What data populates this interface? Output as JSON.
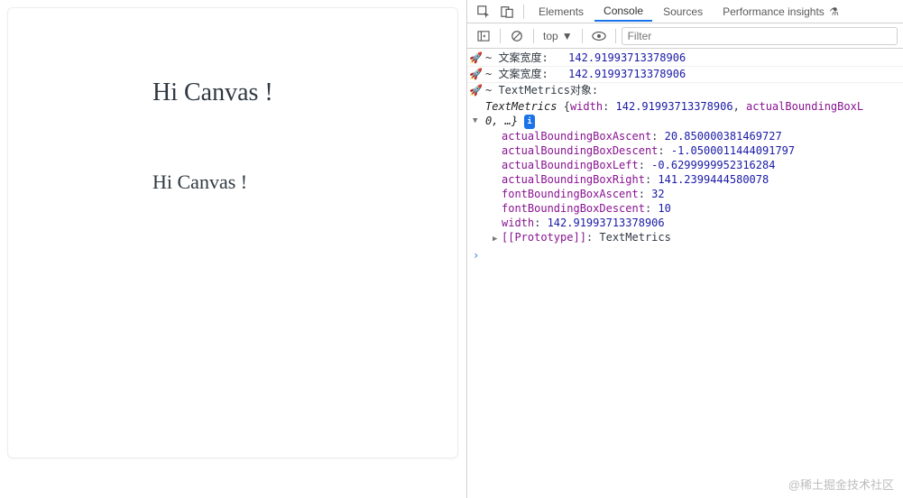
{
  "canvas": {
    "text1": "Hi Canvas !",
    "text2": "Hi Canvas !"
  },
  "devtools": {
    "tabs": {
      "elements": "Elements",
      "console": "Console",
      "sources": "Sources",
      "perf": "Performance insights"
    },
    "filterbar": {
      "context": "top",
      "filter_placeholder": "Filter"
    },
    "console": {
      "rocket": "🚀",
      "log1_label": "~ 文案宽度:",
      "log1_value": "142.91993713378906",
      "log2_label": "~ 文案宽度:",
      "log2_value": "142.91993713378906",
      "log3_label": "~ TextMetrics对象:",
      "summary_pre": "TextMetrics ",
      "summary_open": "{",
      "summary_prop1": "width",
      "summary_sep": ": ",
      "summary_val1": "142.91993713378906",
      "summary_comma": ", ",
      "summary_prop2": "actualBoundingBoxL",
      "line4b": "0, …}",
      "badge_i": "i",
      "props": {
        "p1k": "actualBoundingBoxAscent",
        "p1v": "20.850000381469727",
        "p2k": "actualBoundingBoxDescent",
        "p2v": "-1.0500011444091797",
        "p3k": "actualBoundingBoxLeft",
        "p3v": "-0.6299999952316284",
        "p4k": "actualBoundingBoxRight",
        "p4v": "141.2399444580078",
        "p5k": "fontBoundingBoxAscent",
        "p5v": "32",
        "p6k": "fontBoundingBoxDescent",
        "p6v": "10",
        "p7k": "width",
        "p7v": "142.91993713378906"
      },
      "proto_label": "[[Prototype]]",
      "proto_value": "TextMetrics",
      "prompt": "›"
    }
  },
  "watermark": "@稀土掘金技术社区",
  "icons": {
    "flask": "⚗"
  }
}
